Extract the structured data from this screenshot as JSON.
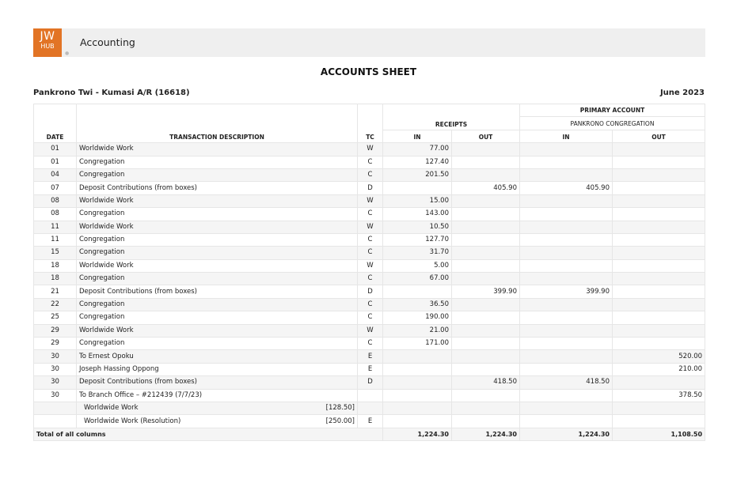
{
  "header": {
    "logo_line1": "JW",
    "logo_line2": "HUB",
    "app_title": "Accounting"
  },
  "page_title": "ACCOUNTS SHEET",
  "account_name": "Pankrono Twi - Kumasi A/R (16618)",
  "period": "June 2023",
  "table": {
    "headers": {
      "date": "DATE",
      "description": "TRANSACTION DESCRIPTION",
      "tc": "TC",
      "receipts": "RECEIPTS",
      "primary_account": "PRIMARY ACCOUNT",
      "primary_account_sub": "PANKRONO CONGREGATION",
      "in": "IN",
      "out": "OUT"
    },
    "rows": [
      {
        "date": "01",
        "desc": "Worldwide Work",
        "tc": "W",
        "r_in": "77.00",
        "r_out": "",
        "p_in": "",
        "p_out": ""
      },
      {
        "date": "01",
        "desc": "Congregation",
        "tc": "C",
        "r_in": "127.40",
        "r_out": "",
        "p_in": "",
        "p_out": ""
      },
      {
        "date": "04",
        "desc": "Congregation",
        "tc": "C",
        "r_in": "201.50",
        "r_out": "",
        "p_in": "",
        "p_out": ""
      },
      {
        "date": "07",
        "desc": "Deposit Contributions (from boxes)",
        "tc": "D",
        "r_in": "",
        "r_out": "405.90",
        "p_in": "405.90",
        "p_out": ""
      },
      {
        "date": "08",
        "desc": "Worldwide Work",
        "tc": "W",
        "r_in": "15.00",
        "r_out": "",
        "p_in": "",
        "p_out": ""
      },
      {
        "date": "08",
        "desc": "Congregation",
        "tc": "C",
        "r_in": "143.00",
        "r_out": "",
        "p_in": "",
        "p_out": ""
      },
      {
        "date": "11",
        "desc": "Worldwide Work",
        "tc": "W",
        "r_in": "10.50",
        "r_out": "",
        "p_in": "",
        "p_out": ""
      },
      {
        "date": "11",
        "desc": "Congregation",
        "tc": "C",
        "r_in": "127.70",
        "r_out": "",
        "p_in": "",
        "p_out": ""
      },
      {
        "date": "15",
        "desc": "Congregation",
        "tc": "C",
        "r_in": "31.70",
        "r_out": "",
        "p_in": "",
        "p_out": ""
      },
      {
        "date": "18",
        "desc": "Worldwide Work",
        "tc": "W",
        "r_in": "5.00",
        "r_out": "",
        "p_in": "",
        "p_out": ""
      },
      {
        "date": "18",
        "desc": "Congregation",
        "tc": "C",
        "r_in": "67.00",
        "r_out": "",
        "p_in": "",
        "p_out": ""
      },
      {
        "date": "21",
        "desc": "Deposit Contributions (from boxes)",
        "tc": "D",
        "r_in": "",
        "r_out": "399.90",
        "p_in": "399.90",
        "p_out": ""
      },
      {
        "date": "22",
        "desc": "Congregation",
        "tc": "C",
        "r_in": "36.50",
        "r_out": "",
        "p_in": "",
        "p_out": ""
      },
      {
        "date": "25",
        "desc": "Congregation",
        "tc": "C",
        "r_in": "190.00",
        "r_out": "",
        "p_in": "",
        "p_out": ""
      },
      {
        "date": "29",
        "desc": "Worldwide Work",
        "tc": "W",
        "r_in": "21.00",
        "r_out": "",
        "p_in": "",
        "p_out": ""
      },
      {
        "date": "29",
        "desc": "Congregation",
        "tc": "C",
        "r_in": "171.00",
        "r_out": "",
        "p_in": "",
        "p_out": ""
      },
      {
        "date": "30",
        "desc": "To Ernest Opoku",
        "tc": "E",
        "r_in": "",
        "r_out": "",
        "p_in": "",
        "p_out": "520.00"
      },
      {
        "date": "30",
        "desc": "Joseph Hassing Oppong",
        "tc": "E",
        "r_in": "",
        "r_out": "",
        "p_in": "",
        "p_out": "210.00"
      },
      {
        "date": "30",
        "desc": "Deposit Contributions (from boxes)",
        "tc": "D",
        "r_in": "",
        "r_out": "418.50",
        "p_in": "418.50",
        "p_out": ""
      },
      {
        "date": "30",
        "desc": "To Branch Office – #212439 (7/7/23)",
        "tc": "",
        "r_in": "",
        "r_out": "",
        "p_in": "",
        "p_out": "378.50"
      }
    ],
    "subrows": [
      {
        "desc": "Worldwide Work",
        "amount": "[128.50]",
        "tc": ""
      },
      {
        "desc": "Worldwide Work (Resolution)",
        "amount": "[250.00]",
        "tc": "E"
      }
    ],
    "totals": {
      "label": "Total of all columns",
      "r_in": "1,224.30",
      "r_out": "1,224.30",
      "p_in": "1,224.30",
      "p_out": "1,108.50"
    }
  }
}
